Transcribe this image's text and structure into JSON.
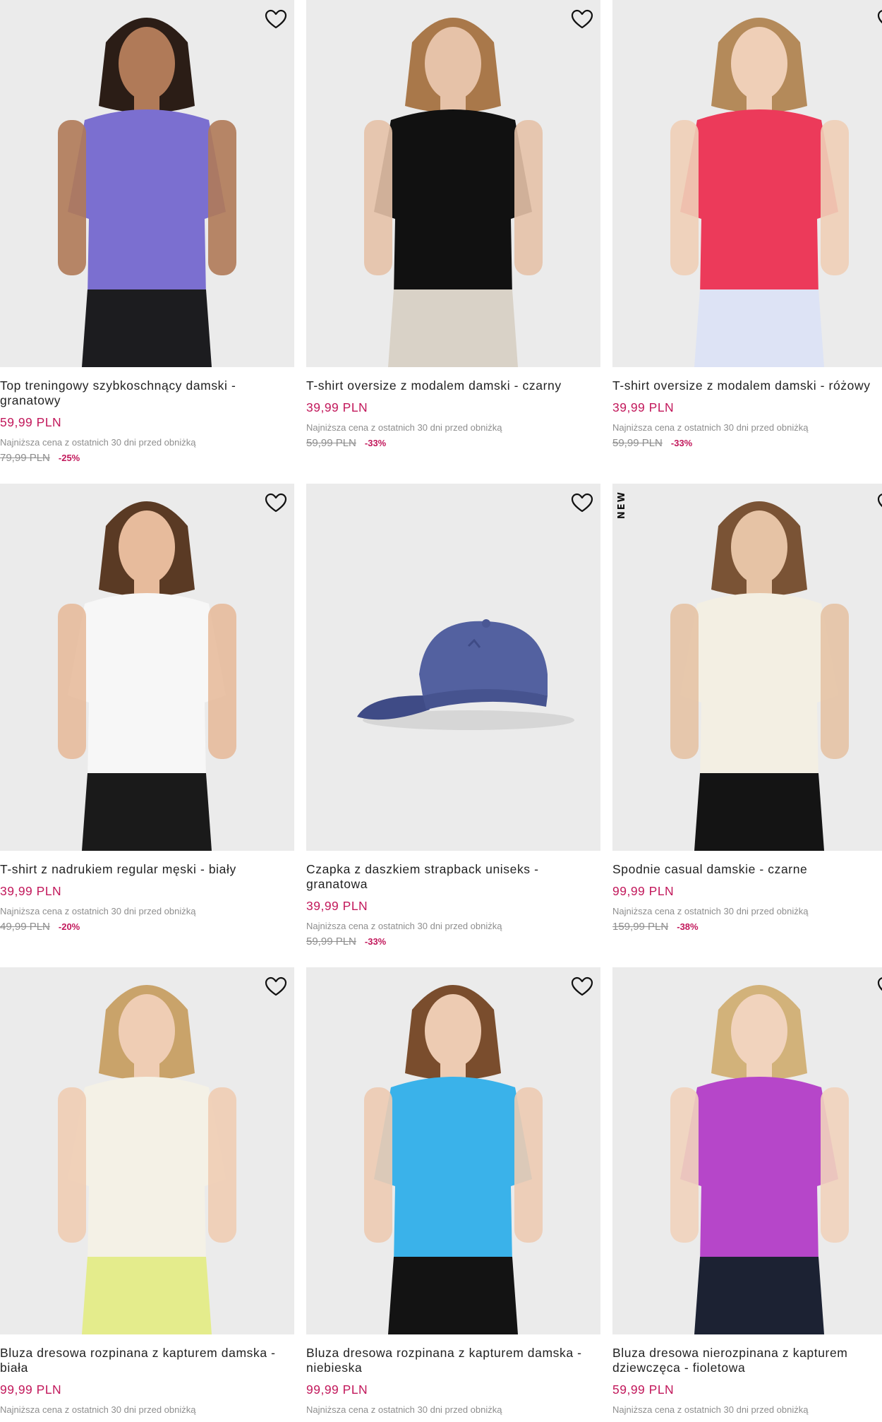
{
  "products": [
    {
      "name": "Top treningowy szybkoschnący damski - granatowy",
      "price": "59,99 PLN",
      "lowest_note": "Najniższa cena z ostatnich 30 dni przed obniżką",
      "old_price": "79,99 PLN",
      "discount": "-25%",
      "badge": "",
      "colors": {
        "top": "#7b6fd0",
        "bottom": "#1c1c1f",
        "skin": "#b07a58",
        "hair": "#2b1d16"
      }
    },
    {
      "name": "T-shirt oversize z modalem damski - czarny",
      "price": "39,99 PLN",
      "lowest_note": "Najniższa cena z ostatnich 30 dni przed obniżką",
      "old_price": "59,99 PLN",
      "discount": "-33%",
      "badge": "",
      "colors": {
        "top": "#111111",
        "bottom": "#d9d2c7",
        "skin": "#e6c2a8",
        "hair": "#a9784a"
      }
    },
    {
      "name": "T-shirt oversize z modalem damski - różowy",
      "price": "39,99 PLN",
      "lowest_note": "Najniższa cena z ostatnich 30 dni przed obniżką",
      "old_price": "59,99 PLN",
      "discount": "-33%",
      "badge": "",
      "colors": {
        "top": "#ec3a5a",
        "bottom": "#dde3f5",
        "skin": "#efcfb7",
        "hair": "#b48a5a"
      }
    },
    {
      "name": "T-shirt z nadrukiem regular męski - biały",
      "price": "39,99 PLN",
      "lowest_note": "Najniższa cena z ostatnich 30 dni przed obniżką",
      "old_price": "49,99 PLN",
      "discount": "-20%",
      "badge": "",
      "colors": {
        "top": "#f7f7f7",
        "bottom": "#1a1a1a",
        "skin": "#e7bb9c",
        "hair": "#5a3a24"
      }
    },
    {
      "name": "Czapka z daszkiem strapback uniseks - granatowa",
      "price": "39,99 PLN",
      "lowest_note": "Najniższa cena z ostatnich 30 dni przed obniżką",
      "old_price": "59,99 PLN",
      "discount": "-33%",
      "badge": "",
      "colors": {
        "top": "#5361a0",
        "bottom": "#3f4b86",
        "skin": "",
        "hair": ""
      }
    },
    {
      "name": "Spodnie casual damskie - czarne",
      "price": "99,99 PLN",
      "lowest_note": "Najniższa cena z ostatnich 30 dni przed obniżką",
      "old_price": "159,99 PLN",
      "discount": "-38%",
      "badge": "NEW",
      "colors": {
        "top": "#f3efe3",
        "bottom": "#141414",
        "skin": "#e6c3a5",
        "hair": "#7a5335"
      }
    },
    {
      "name": "Bluza dresowa rozpinana z kapturem damska - biała",
      "price": "99,99 PLN",
      "lowest_note": "Najniższa cena z ostatnich 30 dni przed obniżką",
      "old_price": "",
      "discount": "",
      "badge": "",
      "colors": {
        "top": "#f4f1e6",
        "bottom": "#e4ec8c",
        "skin": "#efcdb4",
        "hair": "#c9a36a"
      }
    },
    {
      "name": "Bluza dresowa rozpinana z kapturem damska - niebieska",
      "price": "99,99 PLN",
      "lowest_note": "Najniższa cena z ostatnich 30 dni przed obniżką",
      "old_price": "",
      "discount": "",
      "badge": "",
      "colors": {
        "top": "#3ab2ea",
        "bottom": "#131313",
        "skin": "#edcbb2",
        "hair": "#7a4d2d"
      }
    },
    {
      "name": "Bluza dresowa nierozpinana z kapturem dziewczęca - fioletowa",
      "price": "59,99 PLN",
      "lowest_note": "Najniższa cena z ostatnich 30 dni przed obniżką",
      "old_price": "",
      "discount": "",
      "badge": "",
      "colors": {
        "top": "#b646c9",
        "bottom": "#1c2233",
        "skin": "#f1d3bd",
        "hair": "#d2b27a"
      }
    }
  ],
  "icons": {
    "favorite": "heart-outline-icon"
  }
}
